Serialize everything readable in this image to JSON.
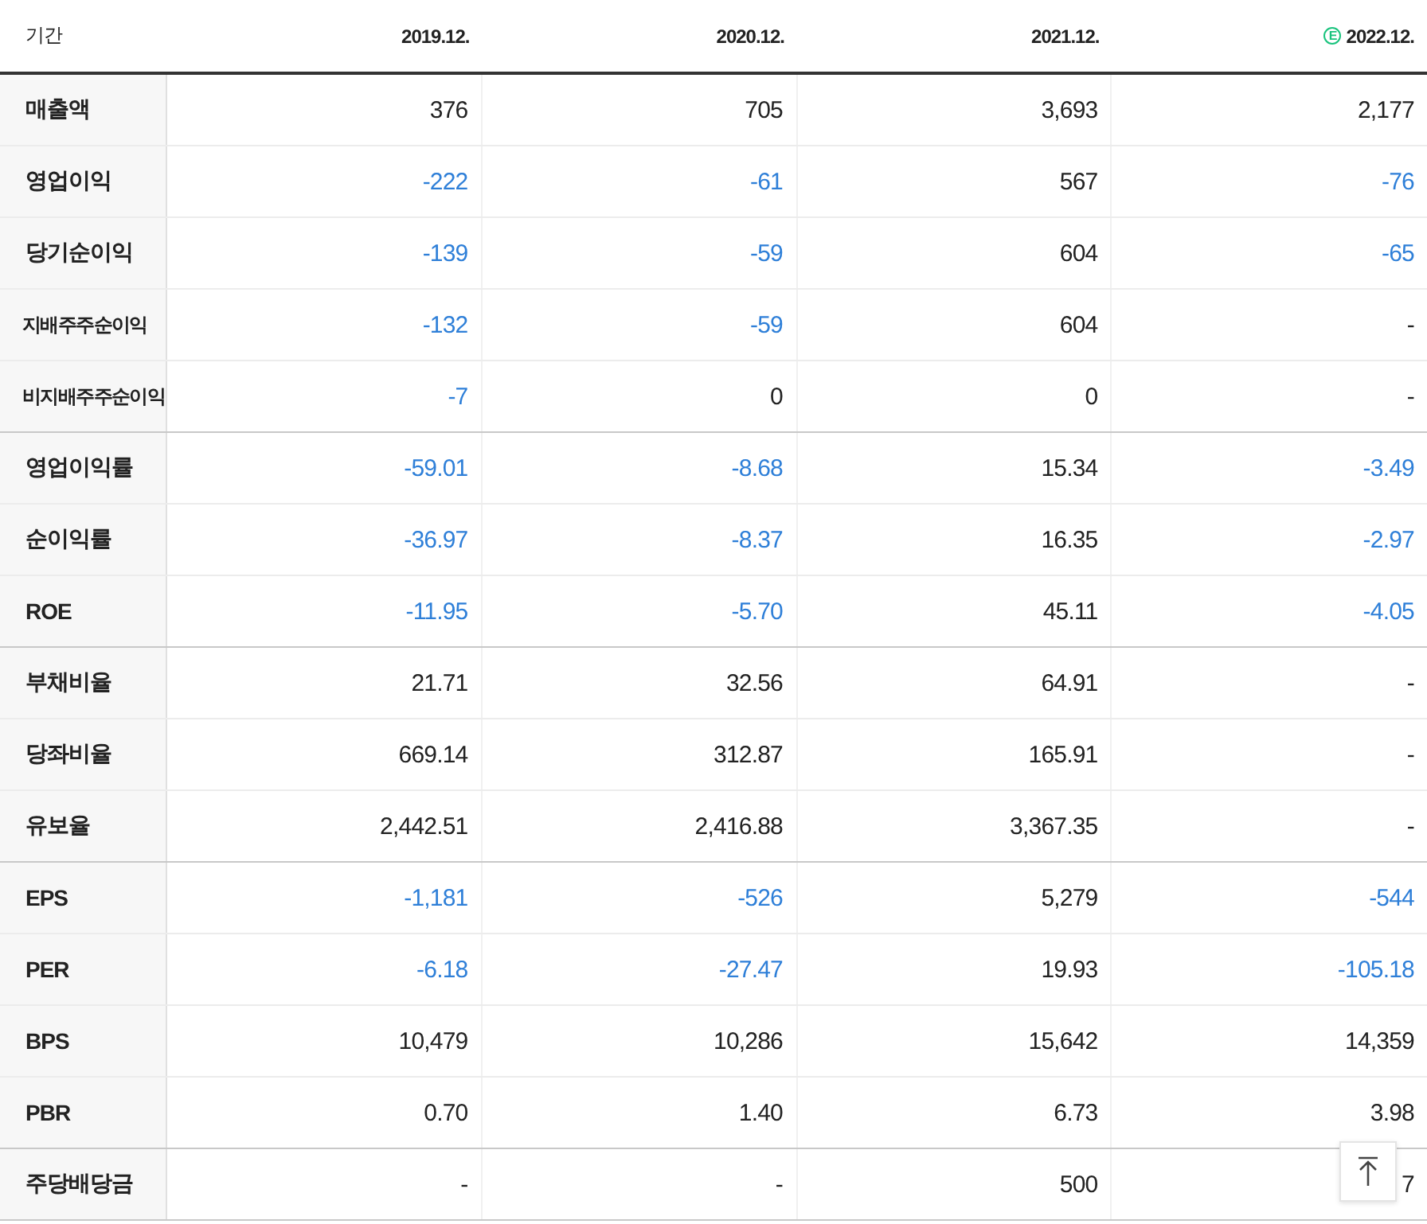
{
  "table": {
    "corner": "기간",
    "columns": [
      {
        "label": "2019.12."
      },
      {
        "label": "2020.12."
      },
      {
        "label": "2021.12."
      },
      {
        "label": "2022.12.",
        "badge": "E"
      }
    ],
    "groups": [
      {
        "rows": [
          {
            "label": "매출액",
            "cells": [
              {
                "text": "376",
                "negative": false
              },
              {
                "text": "705",
                "negative": false
              },
              {
                "text": "3,693",
                "negative": false
              },
              {
                "text": "2,177",
                "negative": false
              }
            ]
          },
          {
            "label": "영업이익",
            "cells": [
              {
                "text": "-222",
                "negative": true
              },
              {
                "text": "-61",
                "negative": true
              },
              {
                "text": "567",
                "negative": false
              },
              {
                "text": "-76",
                "negative": true
              }
            ]
          },
          {
            "label": "당기순이익",
            "cells": [
              {
                "text": "-139",
                "negative": true
              },
              {
                "text": "-59",
                "negative": true
              },
              {
                "text": "604",
                "negative": false
              },
              {
                "text": "-65",
                "negative": true
              }
            ]
          },
          {
            "label": "지배주주순이익",
            "cells": [
              {
                "text": "-132",
                "negative": true
              },
              {
                "text": "-59",
                "negative": true
              },
              {
                "text": "604",
                "negative": false
              },
              {
                "text": "-",
                "negative": false
              }
            ]
          },
          {
            "label": "비지배주주순이익",
            "cells": [
              {
                "text": "-7",
                "negative": true
              },
              {
                "text": "0",
                "negative": false
              },
              {
                "text": "0",
                "negative": false
              },
              {
                "text": "-",
                "negative": false
              }
            ]
          }
        ]
      },
      {
        "rows": [
          {
            "label": "영업이익률",
            "cells": [
              {
                "text": "-59.01",
                "negative": true
              },
              {
                "text": "-8.68",
                "negative": true
              },
              {
                "text": "15.34",
                "negative": false
              },
              {
                "text": "-3.49",
                "negative": true
              }
            ]
          },
          {
            "label": "순이익률",
            "cells": [
              {
                "text": "-36.97",
                "negative": true
              },
              {
                "text": "-8.37",
                "negative": true
              },
              {
                "text": "16.35",
                "negative": false
              },
              {
                "text": "-2.97",
                "negative": true
              }
            ]
          },
          {
            "label": "ROE",
            "cells": [
              {
                "text": "-11.95",
                "negative": true
              },
              {
                "text": "-5.70",
                "negative": true
              },
              {
                "text": "45.11",
                "negative": false
              },
              {
                "text": "-4.05",
                "negative": true
              }
            ]
          }
        ]
      },
      {
        "rows": [
          {
            "label": "부채비율",
            "cells": [
              {
                "text": "21.71",
                "negative": false
              },
              {
                "text": "32.56",
                "negative": false
              },
              {
                "text": "64.91",
                "negative": false
              },
              {
                "text": "-",
                "negative": false
              }
            ]
          },
          {
            "label": "당좌비율",
            "cells": [
              {
                "text": "669.14",
                "negative": false
              },
              {
                "text": "312.87",
                "negative": false
              },
              {
                "text": "165.91",
                "negative": false
              },
              {
                "text": "-",
                "negative": false
              }
            ]
          },
          {
            "label": "유보율",
            "cells": [
              {
                "text": "2,442.51",
                "negative": false
              },
              {
                "text": "2,416.88",
                "negative": false
              },
              {
                "text": "3,367.35",
                "negative": false
              },
              {
                "text": "-",
                "negative": false
              }
            ]
          }
        ]
      },
      {
        "rows": [
          {
            "label": "EPS",
            "cells": [
              {
                "text": "-1,181",
                "negative": true
              },
              {
                "text": "-526",
                "negative": true
              },
              {
                "text": "5,279",
                "negative": false
              },
              {
                "text": "-544",
                "negative": true
              }
            ]
          },
          {
            "label": "PER",
            "cells": [
              {
                "text": "-6.18",
                "negative": true
              },
              {
                "text": "-27.47",
                "negative": true
              },
              {
                "text": "19.93",
                "negative": false
              },
              {
                "text": "-105.18",
                "negative": true
              }
            ]
          },
          {
            "label": "BPS",
            "cells": [
              {
                "text": "10,479",
                "negative": false
              },
              {
                "text": "10,286",
                "negative": false
              },
              {
                "text": "15,642",
                "negative": false
              },
              {
                "text": "14,359",
                "negative": false
              }
            ]
          },
          {
            "label": "PBR",
            "cells": [
              {
                "text": "0.70",
                "negative": false
              },
              {
                "text": "1.40",
                "negative": false
              },
              {
                "text": "6.73",
                "negative": false
              },
              {
                "text": "3.98",
                "negative": false
              }
            ]
          }
        ]
      },
      {
        "rows": [
          {
            "label": "주당배당금",
            "cells": [
              {
                "text": "-",
                "negative": false
              },
              {
                "text": "-",
                "negative": false
              },
              {
                "text": "500",
                "negative": false
              },
              {
                "text": "7",
                "negative": false
              }
            ]
          }
        ]
      }
    ]
  }
}
